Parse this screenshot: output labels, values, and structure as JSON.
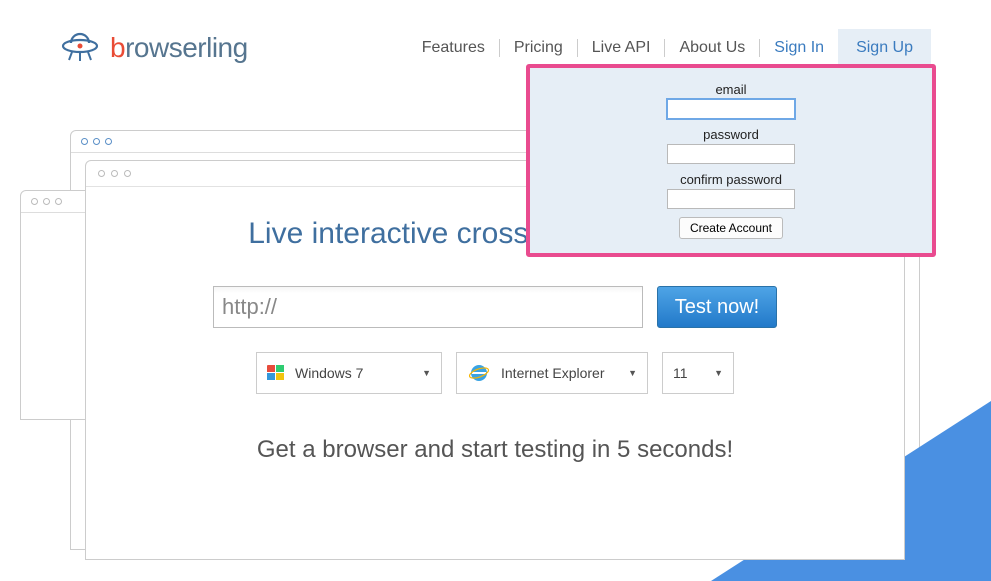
{
  "logo": {
    "brand_first": "b",
    "brand_rest": "rowserling"
  },
  "nav": {
    "features": "Features",
    "pricing": "Pricing",
    "liveapi": "Live API",
    "about": "About Us",
    "signin": "Sign In",
    "signup": "Sign Up"
  },
  "signup_form": {
    "email_label": "email",
    "password_label": "password",
    "confirm_label": "confirm password",
    "submit": "Create Account"
  },
  "hero": "Live interactive cross-browser testing",
  "url_value": "http://",
  "test_button": "Test now!",
  "selects": {
    "os": "Windows 7",
    "browser": "Internet Explorer",
    "version": "11"
  },
  "subhead": "Get a browser and start testing in 5 seconds!"
}
